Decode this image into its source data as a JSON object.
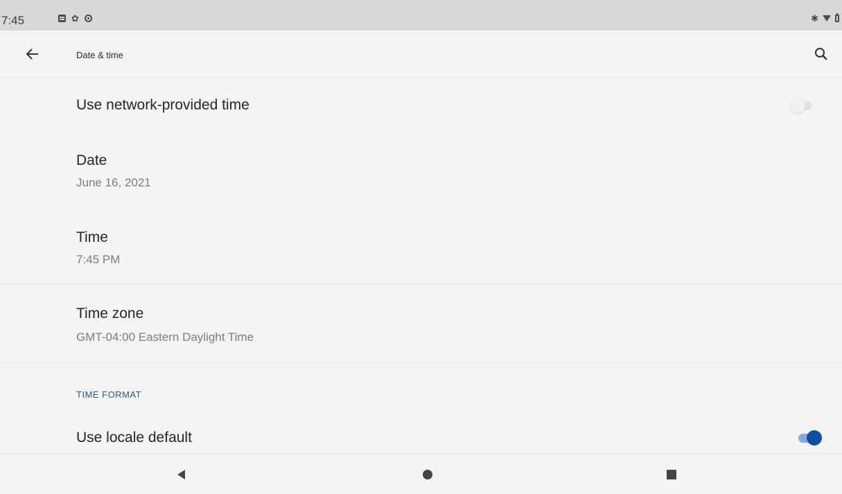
{
  "status_bar": {
    "time": "7:45",
    "left_icons": [
      "message-icon",
      "gear-icon",
      "circle-notification-icon"
    ],
    "right_icons": [
      "bluetooth-icon",
      "wifi-icon",
      "battery-icon"
    ]
  },
  "app_bar": {
    "title": "Date & time",
    "back_icon": "arrow-left-icon",
    "search_icon": "search-icon"
  },
  "settings": {
    "network_time": {
      "title": "Use network-provided time",
      "enabled": false
    },
    "date": {
      "title": "Date",
      "summary": "June 16, 2021"
    },
    "time": {
      "title": "Time",
      "summary": "7:45 PM"
    },
    "time_zone": {
      "title": "Time zone",
      "summary": "GMT-04:00 Eastern Daylight Time"
    },
    "time_format": {
      "category": "TIME FORMAT"
    },
    "locale_default": {
      "title": "Use locale default",
      "enabled": true
    }
  },
  "nav_bar": {
    "buttons": [
      "back-triangle-icon",
      "home-circle-icon",
      "recents-square-icon"
    ]
  },
  "colors": {
    "accent": "#0b4fa3",
    "accent_track": "#8fa8cf",
    "category_text": "#2b5692",
    "background": "#f4f4f4",
    "status_bar": "#d8d8d8"
  }
}
